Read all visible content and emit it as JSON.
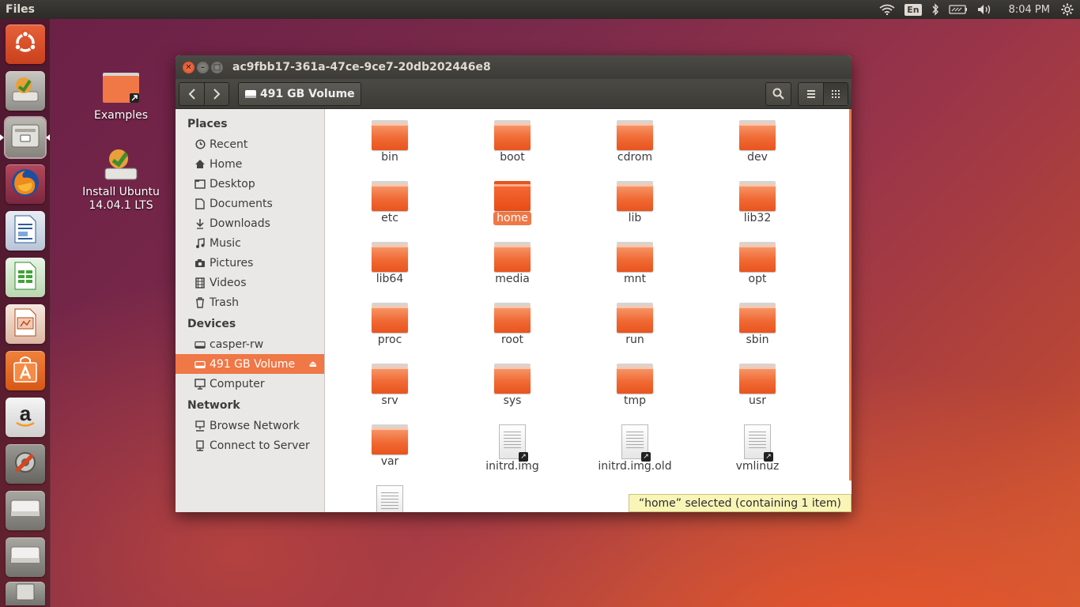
{
  "top_panel": {
    "app_name": "Files",
    "keyboard_layout": "En",
    "clock": "8:04 PM",
    "icons": [
      "wifi-icon",
      "keyboard-layout-indicator",
      "bluetooth-icon",
      "battery-icon",
      "volume-icon",
      "gear-icon"
    ]
  },
  "launcher": {
    "items": [
      {
        "name": "dash-home",
        "icon": "ubuntu-logo-icon"
      },
      {
        "name": "install-ubuntu",
        "icon": "installer-icon"
      },
      {
        "name": "files",
        "icon": "file-cabinet-icon",
        "active": true
      },
      {
        "name": "firefox",
        "icon": "firefox-icon"
      },
      {
        "name": "libreoffice-writer",
        "icon": "writer-icon"
      },
      {
        "name": "libreoffice-calc",
        "icon": "calc-icon"
      },
      {
        "name": "libreoffice-impress",
        "icon": "impress-icon"
      },
      {
        "name": "software-center",
        "icon": "shopping-bag-icon"
      },
      {
        "name": "amazon",
        "icon": "amazon-icon"
      },
      {
        "name": "system-settings",
        "icon": "settings-wrench-icon"
      },
      {
        "name": "drive-1",
        "icon": "drive-icon"
      },
      {
        "name": "drive-2",
        "icon": "drive-icon"
      },
      {
        "name": "trash",
        "icon": "trash-icon"
      }
    ]
  },
  "desktop": {
    "icons": [
      {
        "label": "Examples"
      },
      {
        "label_line1": "Install Ubuntu",
        "label_line2": "14.04.1 LTS"
      }
    ]
  },
  "window": {
    "title": "ac9fbb17-361a-47ce-9ce7-20db202446e8",
    "path_label": "491 GB Volume",
    "sidebar": {
      "places_header": "Places",
      "places": [
        {
          "label": "Recent",
          "icon": "clock-icon"
        },
        {
          "label": "Home",
          "icon": "home-icon"
        },
        {
          "label": "Desktop",
          "icon": "desktop-folder-icon"
        },
        {
          "label": "Documents",
          "icon": "document-icon"
        },
        {
          "label": "Downloads",
          "icon": "download-icon"
        },
        {
          "label": "Music",
          "icon": "music-icon"
        },
        {
          "label": "Pictures",
          "icon": "camera-icon"
        },
        {
          "label": "Videos",
          "icon": "film-icon"
        },
        {
          "label": "Trash",
          "icon": "trash-icon"
        }
      ],
      "devices_header": "Devices",
      "devices": [
        {
          "label": "casper-rw",
          "icon": "drive-icon"
        },
        {
          "label": "491 GB Volume",
          "icon": "drive-icon",
          "selected": true
        },
        {
          "label": "Computer",
          "icon": "computer-icon"
        }
      ],
      "network_header": "Network",
      "network": [
        {
          "label": "Browse Network",
          "icon": "network-icon"
        },
        {
          "label": "Connect to Server",
          "icon": "server-icon"
        }
      ]
    },
    "files": [
      {
        "name": "bin",
        "type": "folder"
      },
      {
        "name": "boot",
        "type": "folder"
      },
      {
        "name": "cdrom",
        "type": "folder"
      },
      {
        "name": "dev",
        "type": "folder"
      },
      {
        "name": "etc",
        "type": "folder"
      },
      {
        "name": "home",
        "type": "folder",
        "selected": true
      },
      {
        "name": "lib",
        "type": "folder"
      },
      {
        "name": "lib32",
        "type": "folder"
      },
      {
        "name": "lib64",
        "type": "folder"
      },
      {
        "name": "media",
        "type": "folder"
      },
      {
        "name": "mnt",
        "type": "folder"
      },
      {
        "name": "opt",
        "type": "folder"
      },
      {
        "name": "proc",
        "type": "folder"
      },
      {
        "name": "root",
        "type": "folder"
      },
      {
        "name": "run",
        "type": "folder"
      },
      {
        "name": "sbin",
        "type": "folder"
      },
      {
        "name": "srv",
        "type": "folder"
      },
      {
        "name": "sys",
        "type": "folder"
      },
      {
        "name": "tmp",
        "type": "folder"
      },
      {
        "name": "usr",
        "type": "folder"
      },
      {
        "name": "var",
        "type": "folder"
      },
      {
        "name": "initrd.img",
        "type": "file-link"
      },
      {
        "name": "initrd.img.old",
        "type": "file-link"
      },
      {
        "name": "vmlinuz",
        "type": "file-link"
      },
      {
        "name": "",
        "type": "file-link"
      }
    ],
    "status": "“home” selected  (containing 1 item)"
  },
  "colors": {
    "accent": "#f07746",
    "panel": "#3c3b37",
    "status_bg": "#f8f5b7"
  }
}
